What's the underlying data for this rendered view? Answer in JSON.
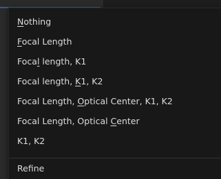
{
  "menu": {
    "items": [
      {
        "pre": "",
        "u": "N",
        "post": "othing"
      },
      {
        "pre": "",
        "u": "F",
        "post": "ocal Length"
      },
      {
        "pre": "Foca",
        "u": "l",
        "post": " length, K1"
      },
      {
        "pre": "Focal length, ",
        "u": "K",
        "post": "1, K2"
      },
      {
        "pre": "Focal Length, ",
        "u": "O",
        "post": "ptical Center, K1, K2"
      },
      {
        "pre": "Focal Length, Optical ",
        "u": "C",
        "post": "enter"
      },
      {
        "pre": "K1, K2",
        "u": "",
        "post": ""
      }
    ],
    "refine_label": "Refine"
  },
  "colors": {
    "menu_background": "#181818",
    "text": "#dcdcdc",
    "separator": "#333333",
    "highlight": "#2b4e74"
  }
}
